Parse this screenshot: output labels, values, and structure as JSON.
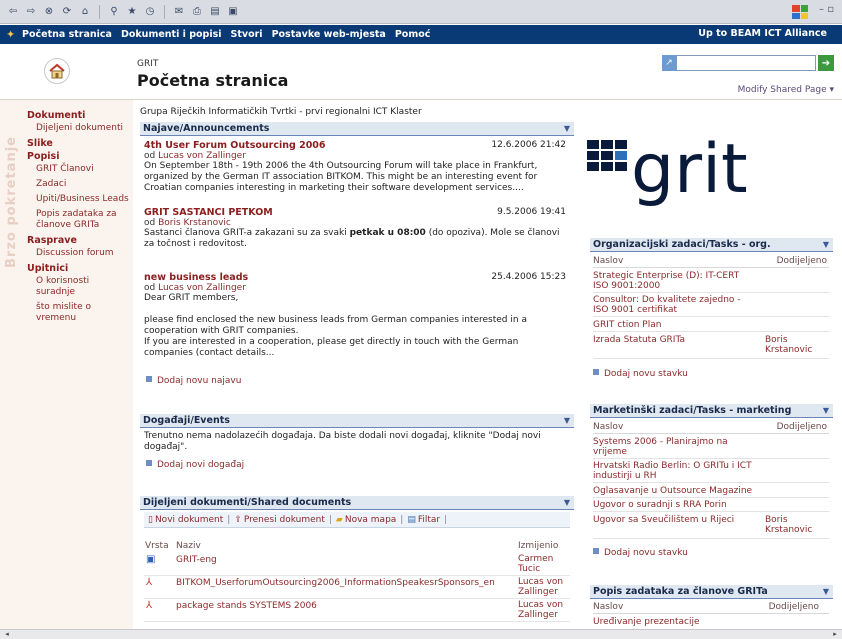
{
  "browser": {
    "toolbar_icons": [
      "back-icon",
      "forward-icon",
      "stop-icon",
      "refresh-icon",
      "home-icon",
      "search-icon",
      "favorites-icon",
      "history-icon",
      "mail-icon",
      "print-icon",
      "edit-icon",
      "discuss-icon"
    ]
  },
  "topnav": {
    "items": [
      "Početna stranica",
      "Dokumenti i popisi",
      "Stvori",
      "Postavke web-mjesta",
      "Pomoć"
    ],
    "right_link": "Up to BEAM ICT Alliance"
  },
  "header": {
    "site_name": "GRIT",
    "page_title": "Početna stranica",
    "modify_link": "Modify Shared Page ▾"
  },
  "quicklaunch": {
    "vertical_text": "Brzo pokretanje",
    "sections": [
      {
        "title": "Dokumenti",
        "items": [
          "Dijeljeni dokumenti"
        ]
      },
      {
        "title": "Slike",
        "items": []
      },
      {
        "title": "Popisi",
        "items": [
          "GRIT Članovi",
          "Zadaci",
          "Upiti/Business Leads",
          "Popis zadataka za članove GRITa"
        ]
      },
      {
        "title": "Rasprave",
        "items": [
          "Discussion forum"
        ]
      },
      {
        "title": "Upitnici",
        "items": [
          "O korisnosti suradnje",
          "što mislite o vremenu"
        ]
      }
    ]
  },
  "description": "Grupa Riječkih Informatičkih Tvrtki - prvi regionalni ICT Klaster",
  "announcements": {
    "title": "Najave/Announcements",
    "items": [
      {
        "title": "4th User Forum Outsourcing 2006",
        "date": "12.6.2006 21:42",
        "by_prefix": "od ",
        "author": "Lucas von Zallinger",
        "body": "On September 18th - 19th 2006 the 4th Outsourcing Forum will take place in Frankfurt, organized by the German IT association BITKOM. This might be an interesting event for Croatian companies interesting in marketing their software development services...."
      },
      {
        "title": "GRIT SASTANCI PETKOM",
        "date": "9.5.2006 19:41",
        "by_prefix": "od ",
        "author": "Boris Krstanovic",
        "body_pre": "Sastanci članova GRIT-a zakazani su za svaki ",
        "body_bold": "petkak u 08:00",
        "body_post": " (do opoziva). Mole se članovi za točnost i redovitost."
      },
      {
        "title": "new business leads",
        "date": "25.4.2006 15:23",
        "by_prefix": "od ",
        "author": "Lucas von Zallinger",
        "body_lines": [
          "Dear GRIT members,",
          "",
          "please find enclosed the new business leads from German companies interested in a cooperation with GRIT companies.",
          "If you are interested in a cooperation, please get directly in touch with the German companies (contact details..."
        ]
      }
    ],
    "add_link": "Dodaj novu najavu"
  },
  "events": {
    "title": "Događaji/Events",
    "body": "Trenutno nema nadolazećih događaja. Da biste dodali novi događaj, kliknite \"Dodaj novi događaj\".",
    "add_link": "Dodaj novi događaj"
  },
  "shared_docs": {
    "title": "Dijeljeni dokumenti/Shared documents",
    "toolbar": [
      "Novi dokument",
      "Prenesi dokument",
      "Nova mapa",
      "Filtar"
    ],
    "col_type": "Vrsta",
    "col_name": "Naziv",
    "col_modified": "Izmijenio",
    "rows": [
      {
        "icon": "word-doc-icon",
        "name": "GRIT-eng",
        "modified": "Carmen Tucic"
      },
      {
        "icon": "pdf-doc-icon",
        "name": "BITKOM_UserforumOutsourcing2006_InformationSpeakesrSponsors_en",
        "modified": "Lucas von Zallinger"
      },
      {
        "icon": "pdf-doc-icon",
        "name": "package stands SYSTEMS 2006",
        "modified": "Lucas von Zallinger"
      }
    ]
  },
  "logo": {
    "text": "grit"
  },
  "org_tasks": {
    "title": "Organizacijski zadaci/Tasks - org.",
    "col_title": "Naslov",
    "col_assigned": "Dodijeljeno",
    "rows": [
      {
        "title": "Strategic Enterprise (D): IT-CERT ISO 9001:2000",
        "assigned": ""
      },
      {
        "title": "Consultor: Do kvalitete zajedno - ISO 9001 certifikat",
        "assigned": ""
      },
      {
        "title": "GRIT ction Plan",
        "assigned": ""
      },
      {
        "title": "Izrada Statuta GRITa",
        "assigned": "Boris Krstanovic"
      }
    ],
    "add_link": "Dodaj novu stavku"
  },
  "marketing_tasks": {
    "title": "Marketinški zadaci/Tasks - marketing",
    "col_title": "Naslov",
    "col_assigned": "Dodijeljeno",
    "rows": [
      {
        "title": "Systems 2006 - Planirajmo na vrijeme",
        "assigned": ""
      },
      {
        "title": "Hrvatski Radio Berlin: O GRITu i ICT industirji u RH",
        "assigned": ""
      },
      {
        "title": "Oglasavanje u Outsource Magazine",
        "assigned": ""
      },
      {
        "title": "Ugovor o suradnji s RRA Porin",
        "assigned": ""
      },
      {
        "title": "Ugovor sa Sveučilištem u Rijeci",
        "assigned": "Boris Krstanovic"
      }
    ],
    "add_link": "Dodaj novu stavku"
  },
  "member_tasks": {
    "title": "Popis zadataka za članove GRITa",
    "col_title": "Naslov",
    "col_assigned": "Dodijeljeno",
    "rows": [
      {
        "title": "Uređivanje prezentacije",
        "assigned": ""
      }
    ]
  },
  "colors": {
    "topnav_bg": "#0a3a75",
    "link": "#8b2a2a",
    "webpart_header_bg": "#dfe7f1",
    "quicklaunch_bg": "#fbf3ee",
    "logo_dark": "#0a1a3a",
    "logo_blue": "#2f6fb8"
  }
}
